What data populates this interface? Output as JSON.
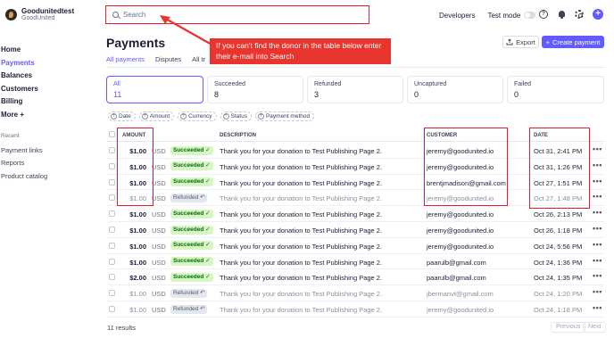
{
  "account": {
    "name": "Goodunitedtest",
    "sub": "GoodUnited"
  },
  "nav": [
    "Home",
    "Payments",
    "Balances",
    "Customers",
    "Billing",
    "More +"
  ],
  "nav_active": "Payments",
  "recent": {
    "title": "Recent",
    "items": [
      "Payment links",
      "Reports",
      "Product catalog"
    ]
  },
  "search": {
    "placeholder": "Search"
  },
  "topbar": {
    "developers": "Developers",
    "test_mode": "Test mode",
    "help_glyph": "?"
  },
  "header": {
    "title": "Payments",
    "export": "Export",
    "create": "Create payment"
  },
  "tabs": [
    "All payments",
    "Disputes",
    "All tr"
  ],
  "annotation": "If you can't find the donor in the table below enter their e-mail into Search",
  "cards": [
    {
      "label": "All",
      "count": "11"
    },
    {
      "label": "Succeeded",
      "count": "8"
    },
    {
      "label": "Refunded",
      "count": "3"
    },
    {
      "label": "Uncaptured",
      "count": "0"
    },
    {
      "label": "Failed",
      "count": "0"
    }
  ],
  "filters": [
    "Date",
    "Amount",
    "Currency",
    "Status",
    "Payment method"
  ],
  "columns": {
    "amount": "AMOUNT",
    "description": "DESCRIPTION",
    "customer": "CUSTOMER",
    "date": "DATE"
  },
  "rows": [
    {
      "amount": "$1.00",
      "currency": "USD",
      "status": "Succeeded",
      "description": "Thank you for your donation to Test Publishing Page 2.",
      "customer": "jeremy@goodunited.io",
      "date": "Oct 31, 2:41 PM"
    },
    {
      "amount": "$1.00",
      "currency": "USD",
      "status": "Succeeded",
      "description": "Thank you for your donation to Test Publishing Page 2.",
      "customer": "jeremy@goodunited.io",
      "date": "Oct 31, 1:26 PM"
    },
    {
      "amount": "$1.00",
      "currency": "USD",
      "status": "Succeeded",
      "description": "Thank you for your donation to Test Publishing Page 2.",
      "customer": "brentjmadison@gmail.com",
      "date": "Oct 27, 1:51 PM"
    },
    {
      "amount": "$1.00",
      "currency": "USD",
      "status": "Refunded",
      "description": "Thank you for your donation to Test Publishing Page 2.",
      "customer": "jeremy@goodunited.io",
      "date": "Oct 27, 1:48 PM"
    },
    {
      "amount": "$1.00",
      "currency": "USD",
      "status": "Succeeded",
      "description": "Thank you for your donation to Test Publishing Page 2.",
      "customer": "jeremy@goodunited.io",
      "date": "Oct 26, 2:13 PM"
    },
    {
      "amount": "$1.00",
      "currency": "USD",
      "status": "Succeeded",
      "description": "Thank you for your donation to Test Publishing Page 2.",
      "customer": "jeremy@goodunited.io",
      "date": "Oct 26, 1:18 PM"
    },
    {
      "amount": "$1.00",
      "currency": "USD",
      "status": "Succeeded",
      "description": "Thank you for your donation to Test Publishing Page 2.",
      "customer": "jeremy@goodunited.io",
      "date": "Oct 24, 5:56 PM"
    },
    {
      "amount": "$1.00",
      "currency": "USD",
      "status": "Succeeded",
      "description": "Thank you for your donation to Test Publishing Page 2.",
      "customer": "paarulb@gmail.com",
      "date": "Oct 24, 1:36 PM"
    },
    {
      "amount": "$2.00",
      "currency": "USD",
      "status": "Succeeded",
      "description": "Thank you for your donation to Test Publishing Page 2.",
      "customer": "paarulb@gmail.com",
      "date": "Oct 24, 1:35 PM"
    },
    {
      "amount": "$1.00",
      "currency": "USD",
      "status": "Refunded",
      "description": "Thank you for your donation to Test Publishing Page 2.",
      "customer": "jbermanvt@gmail.com",
      "date": "Oct 24, 1:20 PM"
    },
    {
      "amount": "$1.00",
      "currency": "USD",
      "status": "Refunded",
      "description": "Thank you for your donation to Test Publishing Page 2.",
      "customer": "jeremy@goodunited.io",
      "date": "Oct 24, 1:18 PM"
    }
  ],
  "footer": {
    "results": "11 results",
    "previous": "Previous",
    "next": "Next"
  },
  "colors": {
    "accent": "#635bff",
    "annotation": "#e8352e",
    "success_bg": "#d7f7c2",
    "success_fg": "#05690d"
  }
}
